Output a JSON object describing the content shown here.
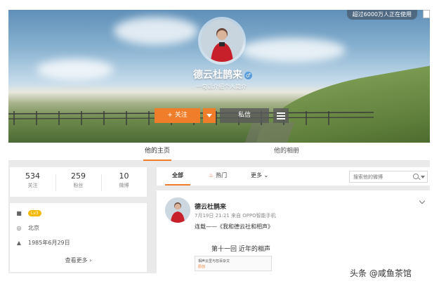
{
  "profile": {
    "online_text": "超过6000万人正在使用",
    "name": "德云杜鹊来",
    "gender_icon": "male-icon",
    "intro": "一句话介绍个人简介",
    "follow_label": "+ 关注",
    "message_label": "私信"
  },
  "nav_tabs": {
    "home": "他的主页",
    "album": "他的相册"
  },
  "stats": [
    {
      "value": "534",
      "label": "关注"
    },
    {
      "value": "259",
      "label": "粉丝"
    },
    {
      "value": "10",
      "label": "微博"
    }
  ],
  "info": {
    "level": "Lv3",
    "location": "北京",
    "birthday": "1985年6月29日",
    "view_more": "查看更多 ›"
  },
  "feed_tabs": {
    "all": "全部",
    "hot": "热门",
    "more": "更多 ⌄",
    "search_placeholder": "搜索他的微博"
  },
  "post": {
    "author": "德云杜鹊来",
    "meta": "7月19日 21:21 来自 OPPO智能手机",
    "text": "连载——《我和德云社和相声》",
    "heading": "第十一回    近年的相声",
    "card_text": "相声云里与恕百杂文",
    "card_tag": "原创"
  },
  "watermark": "头条 @咸鱼茶馆",
  "colors": {
    "accent": "#f07d2a",
    "page_bg": "#eaeaea"
  }
}
